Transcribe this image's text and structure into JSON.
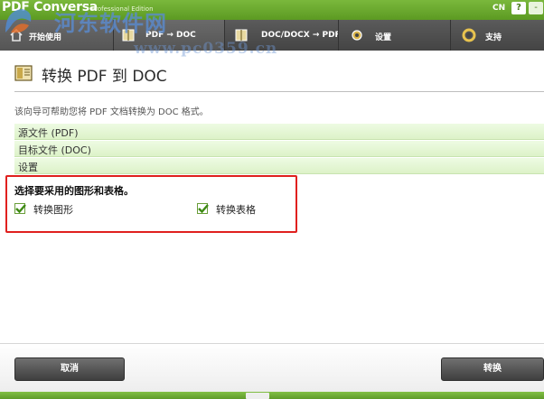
{
  "app": {
    "title": "PDF Conversa",
    "edition": "Professional Edition",
    "language": "CN",
    "help_label": "?",
    "close_label": "-"
  },
  "watermark": {
    "line1": "河东软件网",
    "line2": "www.pc0359.cn"
  },
  "nav": {
    "tabs": [
      {
        "label": "开始使用",
        "icon": "home-icon"
      },
      {
        "label": "PDF → DOC",
        "icon": "book-icon"
      },
      {
        "label": "DOC/DOCX → PDF",
        "icon": "book-icon"
      },
      {
        "label": "设置",
        "icon": "gear-icon"
      },
      {
        "label": "支持",
        "icon": "lifebuoy-icon"
      }
    ]
  },
  "page": {
    "title": "转换 PDF 到 DOC",
    "description": "该向导可帮助您将 PDF 文档转换为 DOC 格式。"
  },
  "sections": [
    {
      "label": "源文件 (PDF)"
    },
    {
      "label": "目标文件 (DOC)"
    },
    {
      "label": "设置"
    }
  ],
  "options": {
    "heading": "选择要采用的图形和表格。",
    "items": [
      {
        "label": "转换图形",
        "checked": true
      },
      {
        "label": "转换表格",
        "checked": true
      }
    ]
  },
  "buttons": {
    "cancel": "取消",
    "convert": "转换"
  },
  "colors": {
    "brand_green": "#6aa830",
    "section_green": "#e4f6d2",
    "highlight_red": "#e0201e",
    "nav_dark": "#444444"
  }
}
